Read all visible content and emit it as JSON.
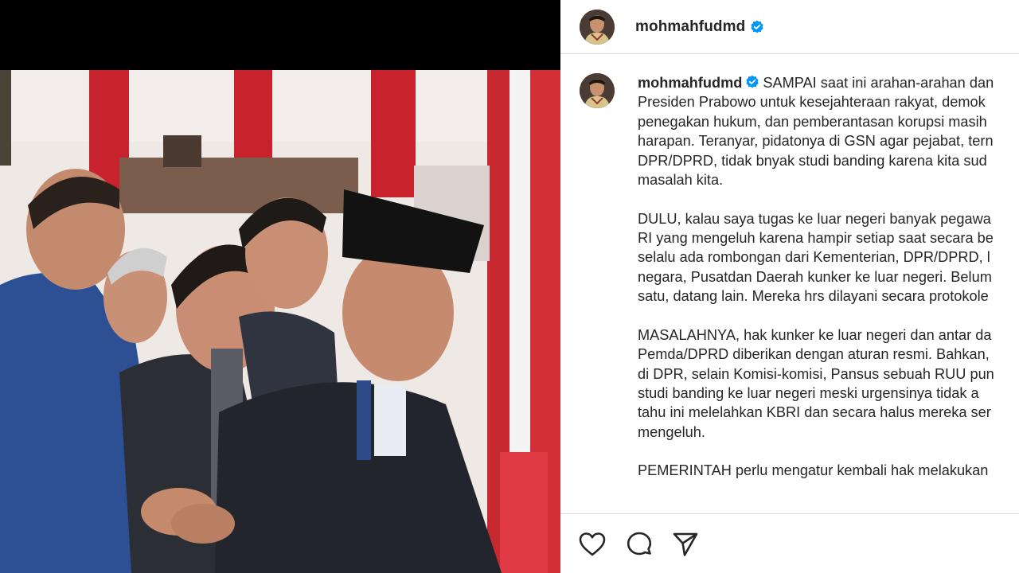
{
  "post": {
    "author": "mohmahfudmd",
    "verified": true
  },
  "caption": {
    "author": "mohmahfudmd",
    "paragraphs": [
      [
        "SAMPAI saat ini arahan-arahan dan",
        "Presiden Prabowo untuk kesejahteraan rakyat, demok",
        "penegakan hukum, dan pemberantasan korupsi masih",
        "harapan. Teranyar, pidatonya di GSN agar pejabat, tern",
        "DPR/DPRD, tidak bnyak studi banding karena kita sud",
        "masalah kita."
      ],
      [
        "DULU, kalau saya tugas ke luar negeri banyak pegawa",
        "RI yang mengeluh karena hampir setiap saat secara be",
        "selalu ada rombongan dari Kementerian, DPR/DPRD, l",
        "negara, Pusatdan Daerah kunker ke luar negeri. Belum",
        "satu, datang lain. Mereka hrs dilayani secara protokole"
      ],
      [
        "MASALAHNYA, hak kunker ke luar negeri dan antar da",
        "Pemda/DPRD diberikan dengan aturan resmi. Bahkan,",
        "di DPR, selain Komisi-komisi, Pansus sebuah RUU pun",
        "studi banding ke luar negeri meski urgensinya tidak a",
        "tahu ini melelahkan KBRI dan secara halus mereka ser",
        "mengeluh."
      ],
      [
        "PEMERINTAH perlu mengatur kembali hak melakukan"
      ]
    ]
  },
  "actions": [
    {
      "name": "like",
      "icon": "heart-icon"
    },
    {
      "name": "comment",
      "icon": "comment-icon"
    },
    {
      "name": "share",
      "icon": "send-icon"
    }
  ],
  "colors": {
    "verified_badge": "#0095f6",
    "divider": "#dbdbdb",
    "text": "#262626"
  }
}
